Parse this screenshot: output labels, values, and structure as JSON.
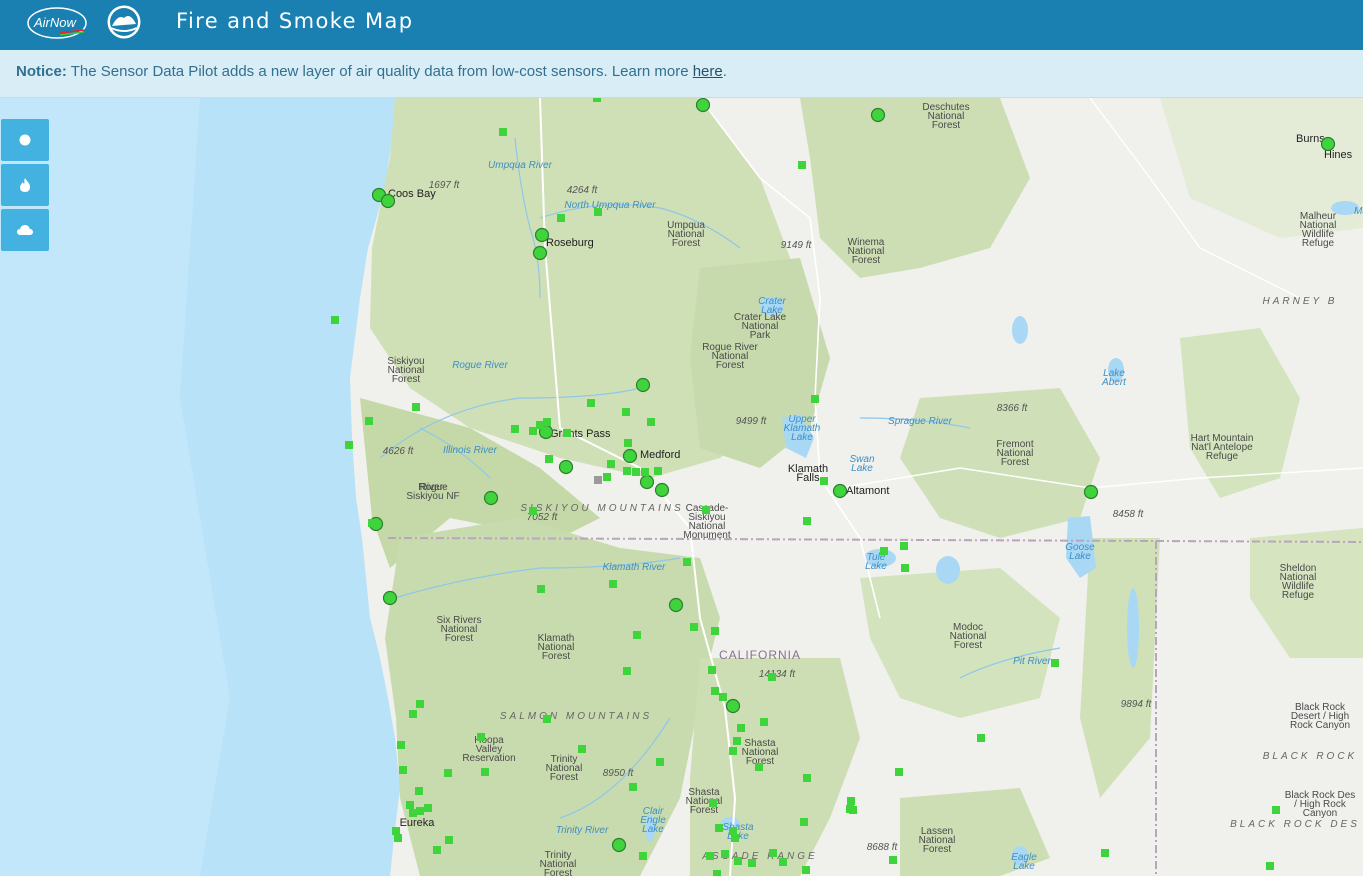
{
  "header": {
    "title": "Fire and Smoke Map",
    "logo_airnow": "AirNow",
    "background": "#1a80b1"
  },
  "notice": {
    "label": "Notice:",
    "text": "The Sensor Data Pilot adds a new layer of air quality data from low-cost sensors. Learn more",
    "link": "here",
    "end": "."
  },
  "controls": [
    {
      "name": "monitors-toggle",
      "icon": "circle-icon"
    },
    {
      "name": "fires-toggle",
      "icon": "flame-icon"
    },
    {
      "name": "smoke-toggle",
      "icon": "cloud-icon"
    }
  ],
  "map": {
    "colors": {
      "ocean": "#b8e2f8",
      "land": "#f1f1ee",
      "forest": "#c9dcb0",
      "marker_good": "#3fd43b",
      "marker_nodata": "#9a9a9a"
    },
    "labels": {
      "cities": [
        "Coos Bay",
        "Roseburg",
        "Grants Pass",
        "Medford",
        "Klamath Falls",
        "Altamont",
        "Eureka",
        "Burns",
        "Hines"
      ],
      "natural": [
        "Deschutes National Forest",
        "Umpqua National Forest",
        "Winema National Forest",
        "Crater Lake National Park",
        "Rogue River National Forest",
        "Siskiyou National Forest",
        "Rogue River-Siskiyou NF",
        "Cascade-Siskiyou National Monument",
        "Fremont National Forest",
        "Hart Mountain Nat'l Antelope Refuge",
        "Malheur National Wildlife Refuge",
        "Sheldon National Wildlife Refuge",
        "Six Rivers National Forest",
        "Klamath National Forest",
        "Modoc National Forest",
        "Shasta National Forest",
        "Hoopa Valley Reservation",
        "Trinity National Forest",
        "Lassen National Forest",
        "Black Rock Desert / High Rock Canyon",
        "Black Rock Desert / High Rock Canyon",
        "Shasta National Forest",
        "Trinity National Forest"
      ],
      "water": [
        "Crater Lake",
        "Upper Klamath Lake",
        "Swan Lake",
        "Tule Lake",
        "Goose Lake",
        "Lake Abert",
        "Clair Engle Lake",
        "Shasta Lake",
        "Eagle Lake",
        "Umpqua River",
        "North Umpqua River",
        "Rogue River",
        "Illinois River",
        "Klamath River",
        "Sprague River",
        "Pit River",
        "Trinity River",
        "Malheur Lake"
      ],
      "elevations": [
        "1697 ft",
        "4264 ft",
        "9149 ft",
        "9499 ft",
        "8366 ft",
        "4626 ft",
        "7052 ft",
        "8458 ft",
        "14134 ft",
        "8950 ft",
        "8688 ft",
        "9894 ft"
      ],
      "regions": [
        "SISKIYOU MOUNTAINS",
        "SALMON MOUNTAINS",
        "CASCADE RANGE",
        "HARNEY BASIN",
        "BLACK ROCK",
        "BLACK ROCK DESERT"
      ],
      "state": "CALIFORNIA"
    }
  }
}
